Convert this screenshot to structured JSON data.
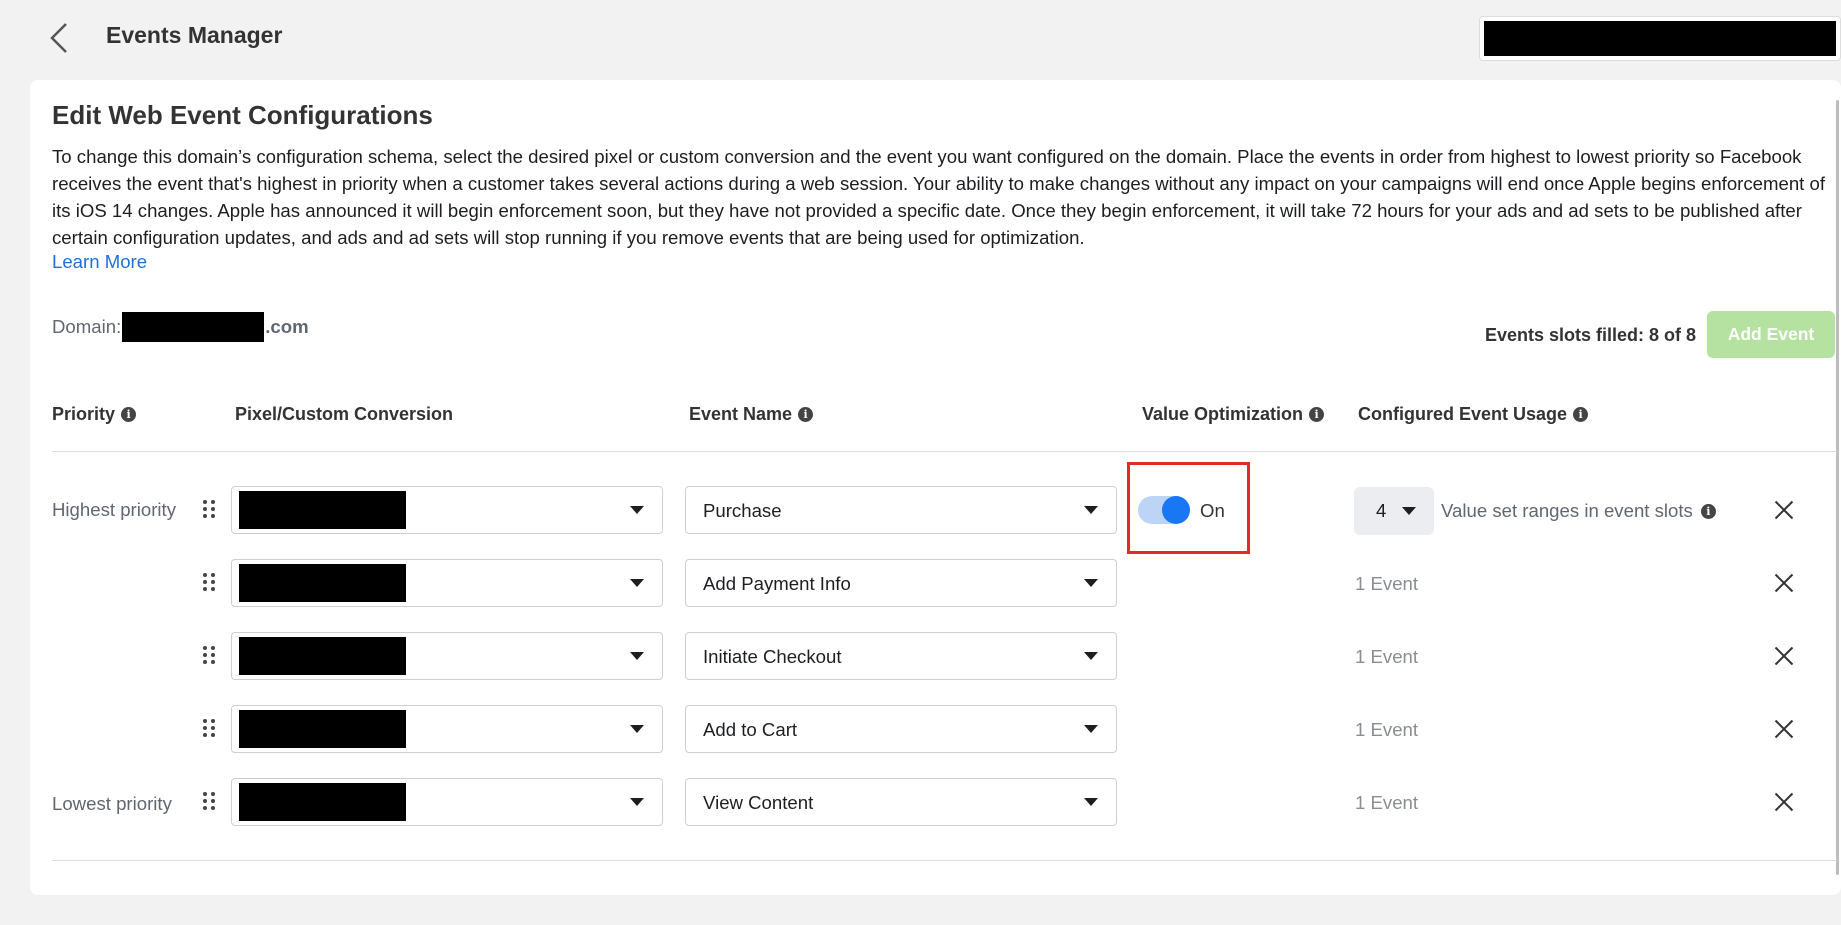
{
  "header": {
    "back_icon": "chevron-left-icon",
    "app_title": "Events Manager"
  },
  "page": {
    "title": "Edit Web Event Configurations",
    "description": "To change this domain’s configuration schema, select the desired pixel or custom conversion and the event you want configured on the domain. Place the events in order from highest to lowest priority so Facebook receives the event that's highest in priority when a customer takes several actions during a web session. Your ability to make changes without any impact on your campaigns will end once Apple begins enforcement of its iOS 14 changes. Apple has announced it will begin enforcement soon, but they have not provided a specific date. Once they begin enforcement, it will take 72 hours for your ads and ad sets to be published after certain configuration updates, and ads and ad sets will stop running if you remove events that are being used for optimization.",
    "learn_more": "Learn More",
    "domain_label": "Domain:",
    "domain_suffix": ".com",
    "slots_filled": "Events slots filled: 8 of 8",
    "add_event": "Add Event"
  },
  "table": {
    "headers": {
      "priority": "Priority",
      "pixel": "Pixel/Custom Conversion",
      "event_name": "Event Name",
      "value_optimization": "Value Optimization",
      "usage": "Configured Event Usage"
    },
    "highest_label": "Highest priority",
    "lowest_label": "Lowest priority",
    "rows": [
      {
        "event": "Purchase",
        "usage": ""
      },
      {
        "event": "Add Payment Info",
        "usage": "1 Event"
      },
      {
        "event": "Initiate Checkout",
        "usage": "1 Event"
      },
      {
        "event": "Add to Cart",
        "usage": "1 Event"
      },
      {
        "event": "View Content",
        "usage": "1 Event"
      }
    ],
    "value_opt": {
      "state": "On",
      "value_ranges": "4",
      "value_ranges_label": "Value set ranges in event slots"
    }
  },
  "colors": {
    "accent": "#1877f2",
    "highlight_border": "#e22b2b",
    "add_event_disabled": "#b5e2a1",
    "link": "#216fdb"
  }
}
